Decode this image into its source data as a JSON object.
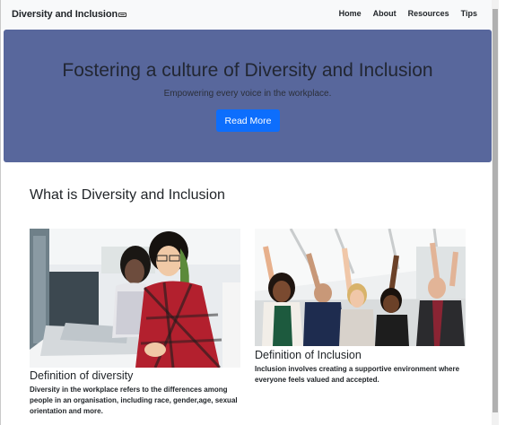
{
  "navbar": {
    "brand": "Diversity and Inclusion",
    "links": [
      "Home",
      "About",
      "Resources",
      "Tips"
    ]
  },
  "hero": {
    "title": "Fostering a culture of Diversity and Inclusion",
    "subtitle": "Empowering every voice in the workplace.",
    "button_label": "Read More"
  },
  "section": {
    "title": "What is Diversity and Inclusion"
  },
  "cards": [
    {
      "title": "Definition of diversity",
      "text": "Diversity in the workplace refers to the differences among people in an organisation, including race, gender,age, sexual orientation and more."
    },
    {
      "title": "Definition of Inclusion",
      "text": "Inclusion involves creating a supportive environment where everyone feels valued and accepted."
    }
  ],
  "colors": {
    "hero_bg": "#58679c",
    "button": "#0d6efd",
    "navbar_bg": "#f8f9fa"
  }
}
